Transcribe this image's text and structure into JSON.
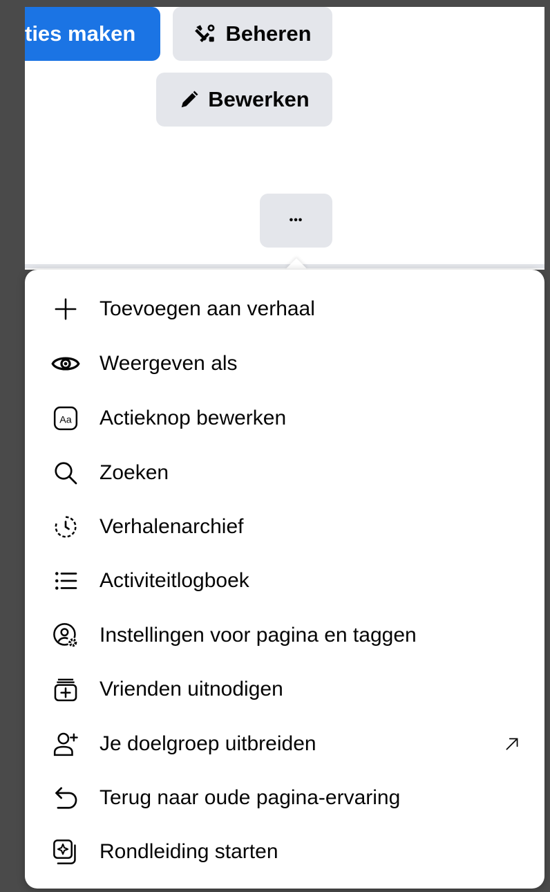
{
  "header": {
    "primary_button_label": "ties maken",
    "manage_button_label": "Beheren",
    "edit_button_label": "Bewerken",
    "more_button_label": "•••"
  },
  "menu": {
    "items": [
      {
        "label": "Toevoegen aan verhaal",
        "icon": "plus-icon"
      },
      {
        "label": "Weergeven als",
        "icon": "eye-icon"
      },
      {
        "label": "Actieknop bewerken",
        "icon": "text-aa-icon"
      },
      {
        "label": "Zoeken",
        "icon": "search-icon"
      },
      {
        "label": "Verhalenarchief",
        "icon": "archive-clock-icon"
      },
      {
        "label": "Activiteitlogboek",
        "icon": "list-icon"
      },
      {
        "label": "Instellingen voor pagina en taggen",
        "icon": "person-gear-icon"
      },
      {
        "label": "Vrienden uitnodigen",
        "icon": "invite-box-icon"
      },
      {
        "label": "Je doelgroep uitbreiden",
        "icon": "add-person-icon",
        "external": true
      },
      {
        "label": "Terug naar oude pagina-ervaring",
        "icon": "undo-icon"
      },
      {
        "label": "Rondleiding starten",
        "icon": "tour-icon"
      }
    ]
  },
  "colors": {
    "primary_blue": "#1b74e4",
    "button_gray": "#e4e6eb",
    "backdrop": "#4a4a4a"
  }
}
